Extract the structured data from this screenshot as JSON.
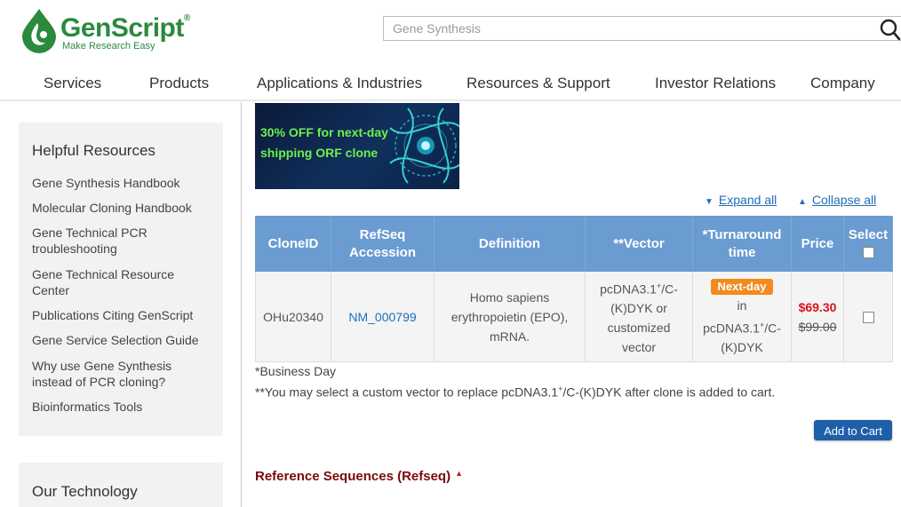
{
  "brand": {
    "name": "GenScript",
    "registered": "®",
    "tagline": "Make Research Easy",
    "color": "#2a8a3e"
  },
  "search": {
    "placeholder": "Gene Synthesis",
    "icon": "search-icon"
  },
  "nav": [
    "Services",
    "Products",
    "Applications & Industries",
    "Resources & Support",
    "Investor Relations",
    "Company"
  ],
  "sidebar": {
    "helpful": {
      "title": "Helpful Resources",
      "links": [
        "Gene Synthesis Handbook",
        "Molecular Cloning Handbook",
        "Gene Technical PCR troubleshooting",
        "Gene Technical Resource Center",
        "Publications Citing GenScript",
        "Gene Service Selection Guide",
        "Why use Gene Synthesis instead of PCR cloning?",
        "Bioinformatics Tools"
      ]
    },
    "technology": {
      "title": "Our Technology"
    }
  },
  "banner": {
    "line1": "30% OFF for next-day",
    "line2": "shipping ORF clone"
  },
  "controls": {
    "expand_all": "Expand all",
    "collapse_all": "Collapse all"
  },
  "table": {
    "headers": {
      "clone_id": "CloneID",
      "refseq_1": "RefSeq",
      "refseq_2": "Accession",
      "definition": "Definition",
      "vector": "**Vector",
      "turnaround_1": "*Turnaround",
      "turnaround_2": "time",
      "price": "Price",
      "select": "Select"
    },
    "row": {
      "clone_id": "OHu20340",
      "accession": "NM_000799",
      "definition": "Homo sapiens erythropoietin (EPO), mRNA.",
      "vector_a": "pcDNA3.1",
      "vector_sup": "+",
      "vector_b": "/C-(K)DYK or customized vector",
      "badge": "Next-day",
      "turn_in": "in",
      "turn_vec_a": "pcDNA3.1",
      "turn_vec_sup": "+",
      "turn_vec_b": "/C-(K)DYK",
      "price_now": "$69.30",
      "price_old": "$99.00"
    }
  },
  "notes": {
    "business_day": "*Business Day",
    "vector_a": "**You may select a custom vector to replace pcDNA3.1",
    "vector_sup": "+",
    "vector_b": "/C-(K)DYK after clone is added to cart."
  },
  "add_to_cart": "Add to Cart",
  "refseq_heading": "Reference Sequences (Refseq)",
  "colors": {
    "header_blue": "#6a9bd1",
    "link_blue": "#1e6fb8",
    "badge_orange": "#f28a1e",
    "price_red": "#d9141c",
    "heading_maroon": "#7a0a0a",
    "button_blue": "#1f5fa8"
  }
}
